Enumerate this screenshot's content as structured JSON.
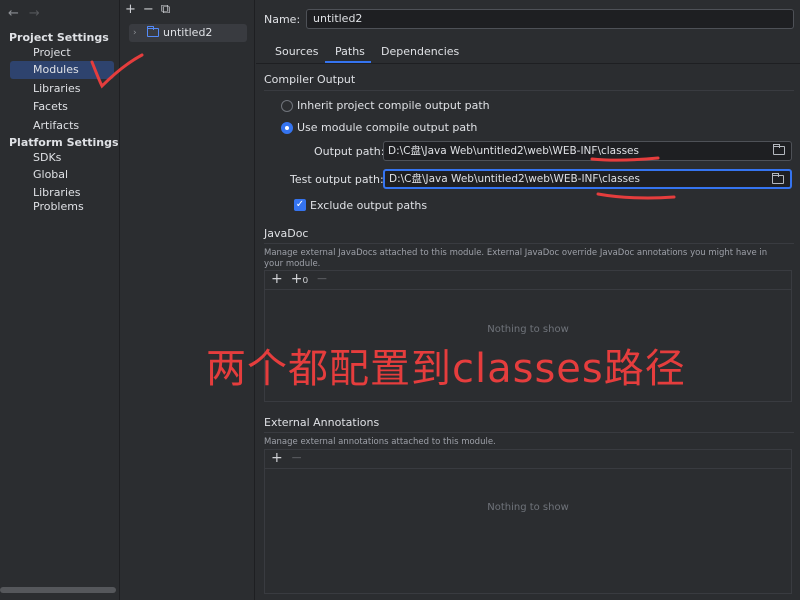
{
  "nav": {
    "back_icon": "←",
    "forward_icon": "→"
  },
  "sidebar": {
    "project_settings_title": "Project Settings",
    "project_items": [
      {
        "label": "Project"
      },
      {
        "label": "Modules",
        "selected": true
      },
      {
        "label": "Libraries"
      },
      {
        "label": "Facets"
      },
      {
        "label": "Artifacts"
      }
    ],
    "platform_settings_title": "Platform Settings",
    "platform_items": [
      {
        "label": "SDKs"
      },
      {
        "label": "Global Libraries"
      }
    ],
    "problems_label": "Problems"
  },
  "tree": {
    "toolbar": {
      "add": "+",
      "remove": "−",
      "copy": "⧉"
    },
    "module_name": "untitled2"
  },
  "detail": {
    "name_label": "Name:",
    "name_value": "untitled2",
    "tabs": [
      {
        "label": "Sources"
      },
      {
        "label": "Paths",
        "selected": true
      },
      {
        "label": "Dependencies"
      }
    ],
    "compiler_output": {
      "title": "Compiler Output",
      "inherit_label": "Inherit project compile output path",
      "use_module_label": "Use module compile output path",
      "selected_option": "use_module",
      "output_path_label": "Output path:",
      "output_path_value": "D:\\C盘\\Java Web\\untitled2\\web\\WEB-INF\\classes",
      "test_output_path_label": "Test output path:",
      "test_output_path_value": "D:\\C盘\\Java Web\\untitled2\\web\\WEB-INF\\classes",
      "exclude_label": "Exclude output paths",
      "exclude_checked": true
    },
    "javadoc": {
      "title": "JavaDoc",
      "description": "Manage external JavaDocs attached to this module. External JavaDoc override JavaDoc annotations you might have in your module.",
      "empty_text": "Nothing to show"
    },
    "external_annotations": {
      "title": "External Annotations",
      "description": "Manage external annotations attached to this module.",
      "empty_text": "Nothing to show"
    }
  },
  "annotation": {
    "text": "两个都配置到classes路径",
    "color": "#e53d3d"
  },
  "colors": {
    "background": "#2b2d30",
    "selection": "#2e436e",
    "accent": "#3574f0"
  }
}
